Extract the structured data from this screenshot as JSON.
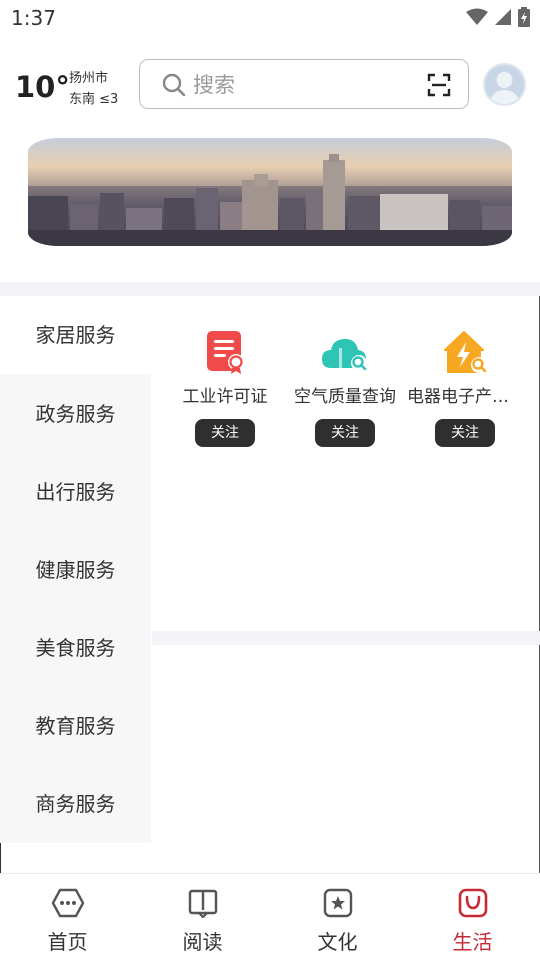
{
  "status_bar": {
    "time": "1:37"
  },
  "weather": {
    "temperature": "10°",
    "city": "扬州市",
    "wind": "东南 ≤3"
  },
  "search": {
    "placeholder": "搜索"
  },
  "side_menu": {
    "items": [
      {
        "label": "家居服务",
        "active": true
      },
      {
        "label": "政务服务",
        "active": false
      },
      {
        "label": "出行服务",
        "active": false
      },
      {
        "label": "健康服务",
        "active": false
      },
      {
        "label": "美食服务",
        "active": false
      },
      {
        "label": "教育服务",
        "active": false
      },
      {
        "label": "商务服务",
        "active": false
      }
    ]
  },
  "services": [
    {
      "name": "工业许可证",
      "icon": "license-certificate-icon",
      "color": "#f04a4a",
      "button": "关注"
    },
    {
      "name": "空气质量查询",
      "icon": "cloud-search-icon",
      "color": "#2ec4b6",
      "button": "关注"
    },
    {
      "name": "电器电子产品...",
      "icon": "house-lightning-icon",
      "color": "#f7a823",
      "button": "关注"
    }
  ],
  "bottom_nav": {
    "items": [
      {
        "label": "首页",
        "icon": "home-chat-icon",
        "active": false
      },
      {
        "label": "阅读",
        "icon": "book-icon",
        "active": false
      },
      {
        "label": "文化",
        "icon": "star-icon",
        "active": false
      },
      {
        "label": "生活",
        "icon": "shopping-bag-icon",
        "active": true
      }
    ],
    "active_color": "#c62a36"
  }
}
